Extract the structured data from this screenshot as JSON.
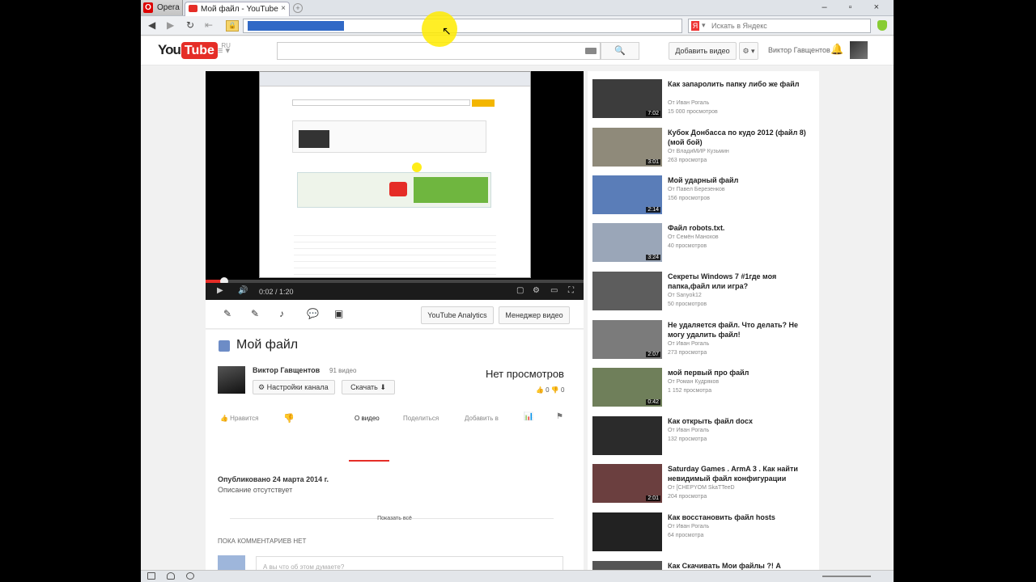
{
  "browser": {
    "menu_label": "Opera",
    "tab_title": "Мой файл - YouTube",
    "tab_close": "×",
    "new_tab": "+",
    "window_controls": "– ▫ ×",
    "search_engine_placeholder": "Искать в Яндекс",
    "icons": [
      "back-icon",
      "forward-icon",
      "reload-icon",
      "home-icon",
      "lock-icon"
    ]
  },
  "yt_header": {
    "logo_you": "You",
    "logo_tube": "Tube",
    "logo_region": "RU",
    "guide_label": "≡ ▾",
    "search_button": "🔍",
    "upload_label": "Добавить видео",
    "settings_label": "⚙ ▾",
    "user_name": "Виктор Гавщентов",
    "bell": "🔔"
  },
  "player": {
    "play": "▶",
    "volume": "🔊",
    "time": "0:02 / 1:20",
    "progress_fraction": 0.05,
    "cc": "▢",
    "settings": "⚙",
    "theater": "▭",
    "fullscreen": "⛶"
  },
  "actions": {
    "icons": [
      "✎",
      "✎",
      "♪",
      "💬",
      "▣"
    ],
    "analytics_label": "YouTube Analytics",
    "manager_label": "Менеджер видео"
  },
  "video": {
    "title": "Мой файл",
    "channel_name": "Виктор Гавщентов",
    "video_count": "91 видео",
    "channel_settings_label": "⚙  Настройки канала",
    "download_label": "Скачать ⬇",
    "views": "Нет просмотров",
    "likes": "👍 0    👎 0",
    "like_label": "👍  Нравится",
    "dislike_icon": "👎",
    "tabs": [
      "О видео",
      "Поделиться",
      "Добавить в"
    ],
    "stats_icon": "📊",
    "flag_icon": "⚑",
    "published": "Опубликовано 24 марта 2014 г.",
    "description": "Описание отсутствует",
    "show_all": "Показать всё",
    "comments_header": "ПОКА КОММЕНТАРИЕВ НЕТ",
    "comment_placeholder": "А вы что об этом думаете?"
  },
  "recommendations": [
    {
      "title": "Как запаролить папку либо же файл",
      "channel": "От Иван Рогаль",
      "views": "15 000 просмотров",
      "duration": "7:02",
      "thumb": "#3c3c3c"
    },
    {
      "title": "Кубок Донбасса по кудо 2012 (файл 8) (мой бой)",
      "channel": "От ВладиМИР Кузьмин",
      "views": "263 просмотра",
      "duration": "3:01",
      "thumb": "#8f8a7a"
    },
    {
      "title": "Мой ударный файл",
      "channel": "От Павел Березенков",
      "views": "156 просмотров",
      "duration": "2:14",
      "thumb": "#5a7db8"
    },
    {
      "title": "Файл robots.txt.",
      "channel": "От Семён Манохов",
      "views": "40 просмотров",
      "duration": "3:24",
      "thumb": "#9aa6b8"
    },
    {
      "title": "Секреты Windows 7 #1где моя папка,файл или игра?",
      "channel": "От Sanyok12",
      "views": "50 просмотров",
      "duration": "",
      "thumb": "#5d5d5d"
    },
    {
      "title": "Не удаляется файл. Что делать? Не могу удалить файл!",
      "channel": "От Иван Рогаль",
      "views": "273 просмотра",
      "duration": "2:07",
      "thumb": "#7b7b7b"
    },
    {
      "title": "мой первый про файл",
      "channel": "От Роман Кудряков",
      "views": "1 152 просмотра",
      "duration": "0:42",
      "thumb": "#6f7f5a"
    },
    {
      "title": "Как открыть файл docx",
      "channel": "От Иван Рогаль",
      "views": "132 просмотра",
      "duration": "",
      "thumb": "#2b2b2b"
    },
    {
      "title": "Saturday Games . ArmA 3 . Как найти невидимый файл конфигурации",
      "channel": "От [CHEPYOM SkaTTeeD",
      "views": "204 просмотра",
      "duration": "2:01",
      "thumb": "#6b3f3f"
    },
    {
      "title": "Как восстановить файл hosts",
      "channel": "От Иван Рогаль",
      "views": "64 просмотра",
      "duration": "",
      "thumb": "#222222"
    },
    {
      "title": "Как Скачивать Мои файлы ?! А",
      "channel": "",
      "views": "",
      "duration": "",
      "thumb": "#555555"
    }
  ]
}
